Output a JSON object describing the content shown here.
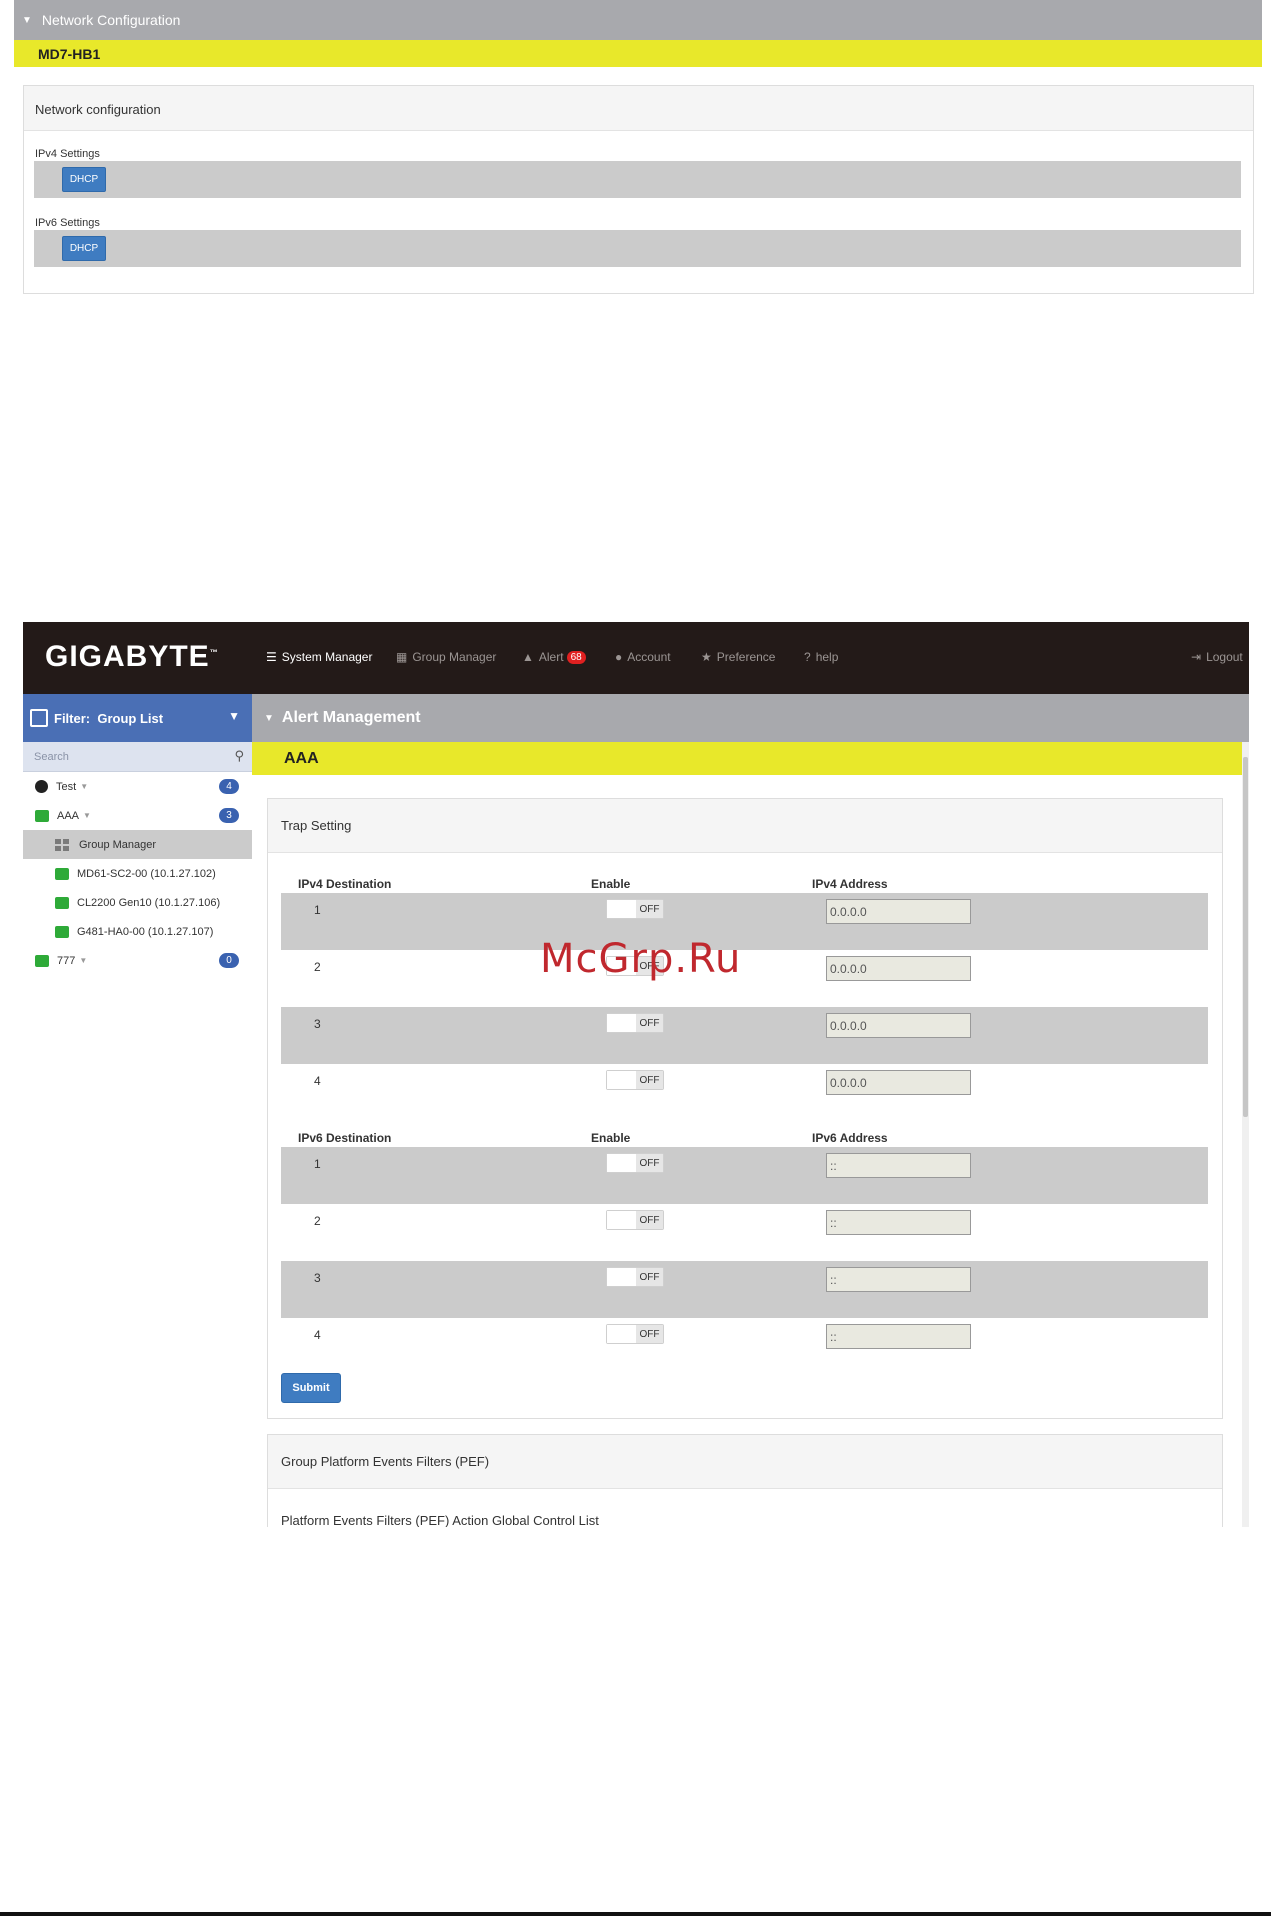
{
  "network_config": {
    "header": "Network Configuration",
    "device": "MD7-HB1",
    "panel_title": "Network configuration",
    "ipv4_label": "IPv4 Settings",
    "ipv4_button": "DHCP",
    "ipv6_label": "IPv6 Settings",
    "ipv6_button": "DHCP"
  },
  "navbar": {
    "logo": "GIGABYTE",
    "logo_tm": "™",
    "items": [
      {
        "label": "System Manager",
        "icon": "list-icon"
      },
      {
        "label": "Group Manager",
        "icon": "grid-icon"
      },
      {
        "label": "Alert",
        "icon": "warning-icon",
        "badge": "68"
      },
      {
        "label": "Account",
        "icon": "user-icon"
      },
      {
        "label": "Preference",
        "icon": "star-icon"
      },
      {
        "label": "help",
        "icon": "question-icon"
      }
    ],
    "logout": "Logout"
  },
  "sidebar": {
    "filter_label": "Filter:",
    "filter_value": "Group List",
    "search_placeholder": "Search",
    "tree": [
      {
        "label": "Test",
        "count": "4"
      },
      {
        "label": "AAA",
        "count": "3"
      },
      {
        "label": "Group Manager"
      },
      {
        "label": "MD61-SC2-00 (10.1.27.102)"
      },
      {
        "label": "CL2200 Gen10 (10.1.27.106)"
      },
      {
        "label": "G481-HA0-00 (10.1.27.107)"
      },
      {
        "label": "777",
        "count": "0"
      }
    ]
  },
  "main": {
    "section_title": "Alert Management",
    "group_name": "AAA",
    "trap": {
      "title": "Trap Setting",
      "ipv4_col": "IPv4 Destination",
      "ipv4_enable_col": "Enable",
      "ipv4_addr_col": "IPv4 Address",
      "ipv4_rows": [
        {
          "num": "1",
          "toggle": "OFF",
          "addr": "0.0.0.0"
        },
        {
          "num": "2",
          "toggle": "OFF",
          "addr": "0.0.0.0"
        },
        {
          "num": "3",
          "toggle": "OFF",
          "addr": "0.0.0.0"
        },
        {
          "num": "4",
          "toggle": "OFF",
          "addr": "0.0.0.0"
        }
      ],
      "ipv6_col": "IPv6 Destination",
      "ipv6_enable_col": "Enable",
      "ipv6_addr_col": "IPv6 Address",
      "ipv6_rows": [
        {
          "num": "1",
          "toggle": "OFF",
          "addr": "::"
        },
        {
          "num": "2",
          "toggle": "OFF",
          "addr": "::"
        },
        {
          "num": "3",
          "toggle": "OFF",
          "addr": "::"
        },
        {
          "num": "4",
          "toggle": "OFF",
          "addr": "::"
        }
      ],
      "submit": "Submit"
    },
    "pef": {
      "title": "Group Platform Events Filters (PEF)",
      "subtitle": "Platform Events Filters (PEF) Action Global Control List"
    }
  },
  "watermark": "McGrp.Ru"
}
